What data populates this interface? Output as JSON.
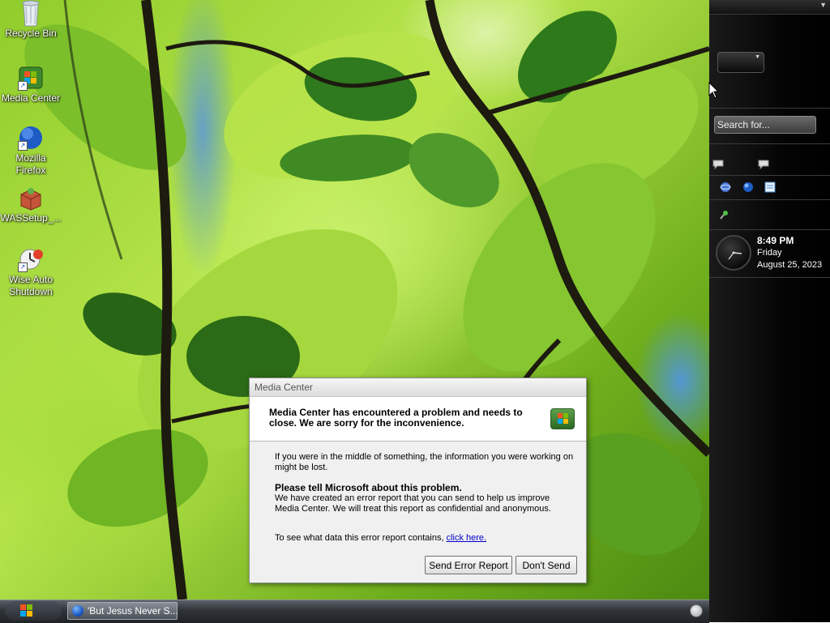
{
  "desktop": {
    "icons": [
      {
        "label": "Recycle Bin",
        "icon": "recycle-bin-icon"
      },
      {
        "label": "Media Center",
        "icon": "media-center-icon"
      },
      {
        "label": "Mozilla Firefox",
        "icon": "firefox-icon"
      },
      {
        "label": "WASSetup_...",
        "icon": "setup-package-icon"
      },
      {
        "label": "Wise Auto Shutdown",
        "icon": "wise-auto-shutdown-icon"
      }
    ]
  },
  "sidebar": {
    "search_placeholder": "Search for...",
    "clock": {
      "time": "8:49 PM",
      "day": "Friday",
      "date": "August 25, 2023"
    }
  },
  "taskbar": {
    "task_item": "'But Jesus Never S..."
  },
  "dialog": {
    "title": "Media Center",
    "heading": "Media Center has encountered a problem and needs to close.  We are sorry for the inconvenience.",
    "info": "If you were in the middle of something, the information you were working on might be lost.",
    "tell_heading": "Please tell Microsoft about this problem.",
    "tell_body": "We have created an error report that you can send to help us improve Media Center.  We will treat this report as confidential and anonymous.",
    "see_data_prefix": "To see what data this error report contains, ",
    "see_data_link": "click here.",
    "send_button": "Send Error Report",
    "dont_send_button": "Don't Send"
  }
}
